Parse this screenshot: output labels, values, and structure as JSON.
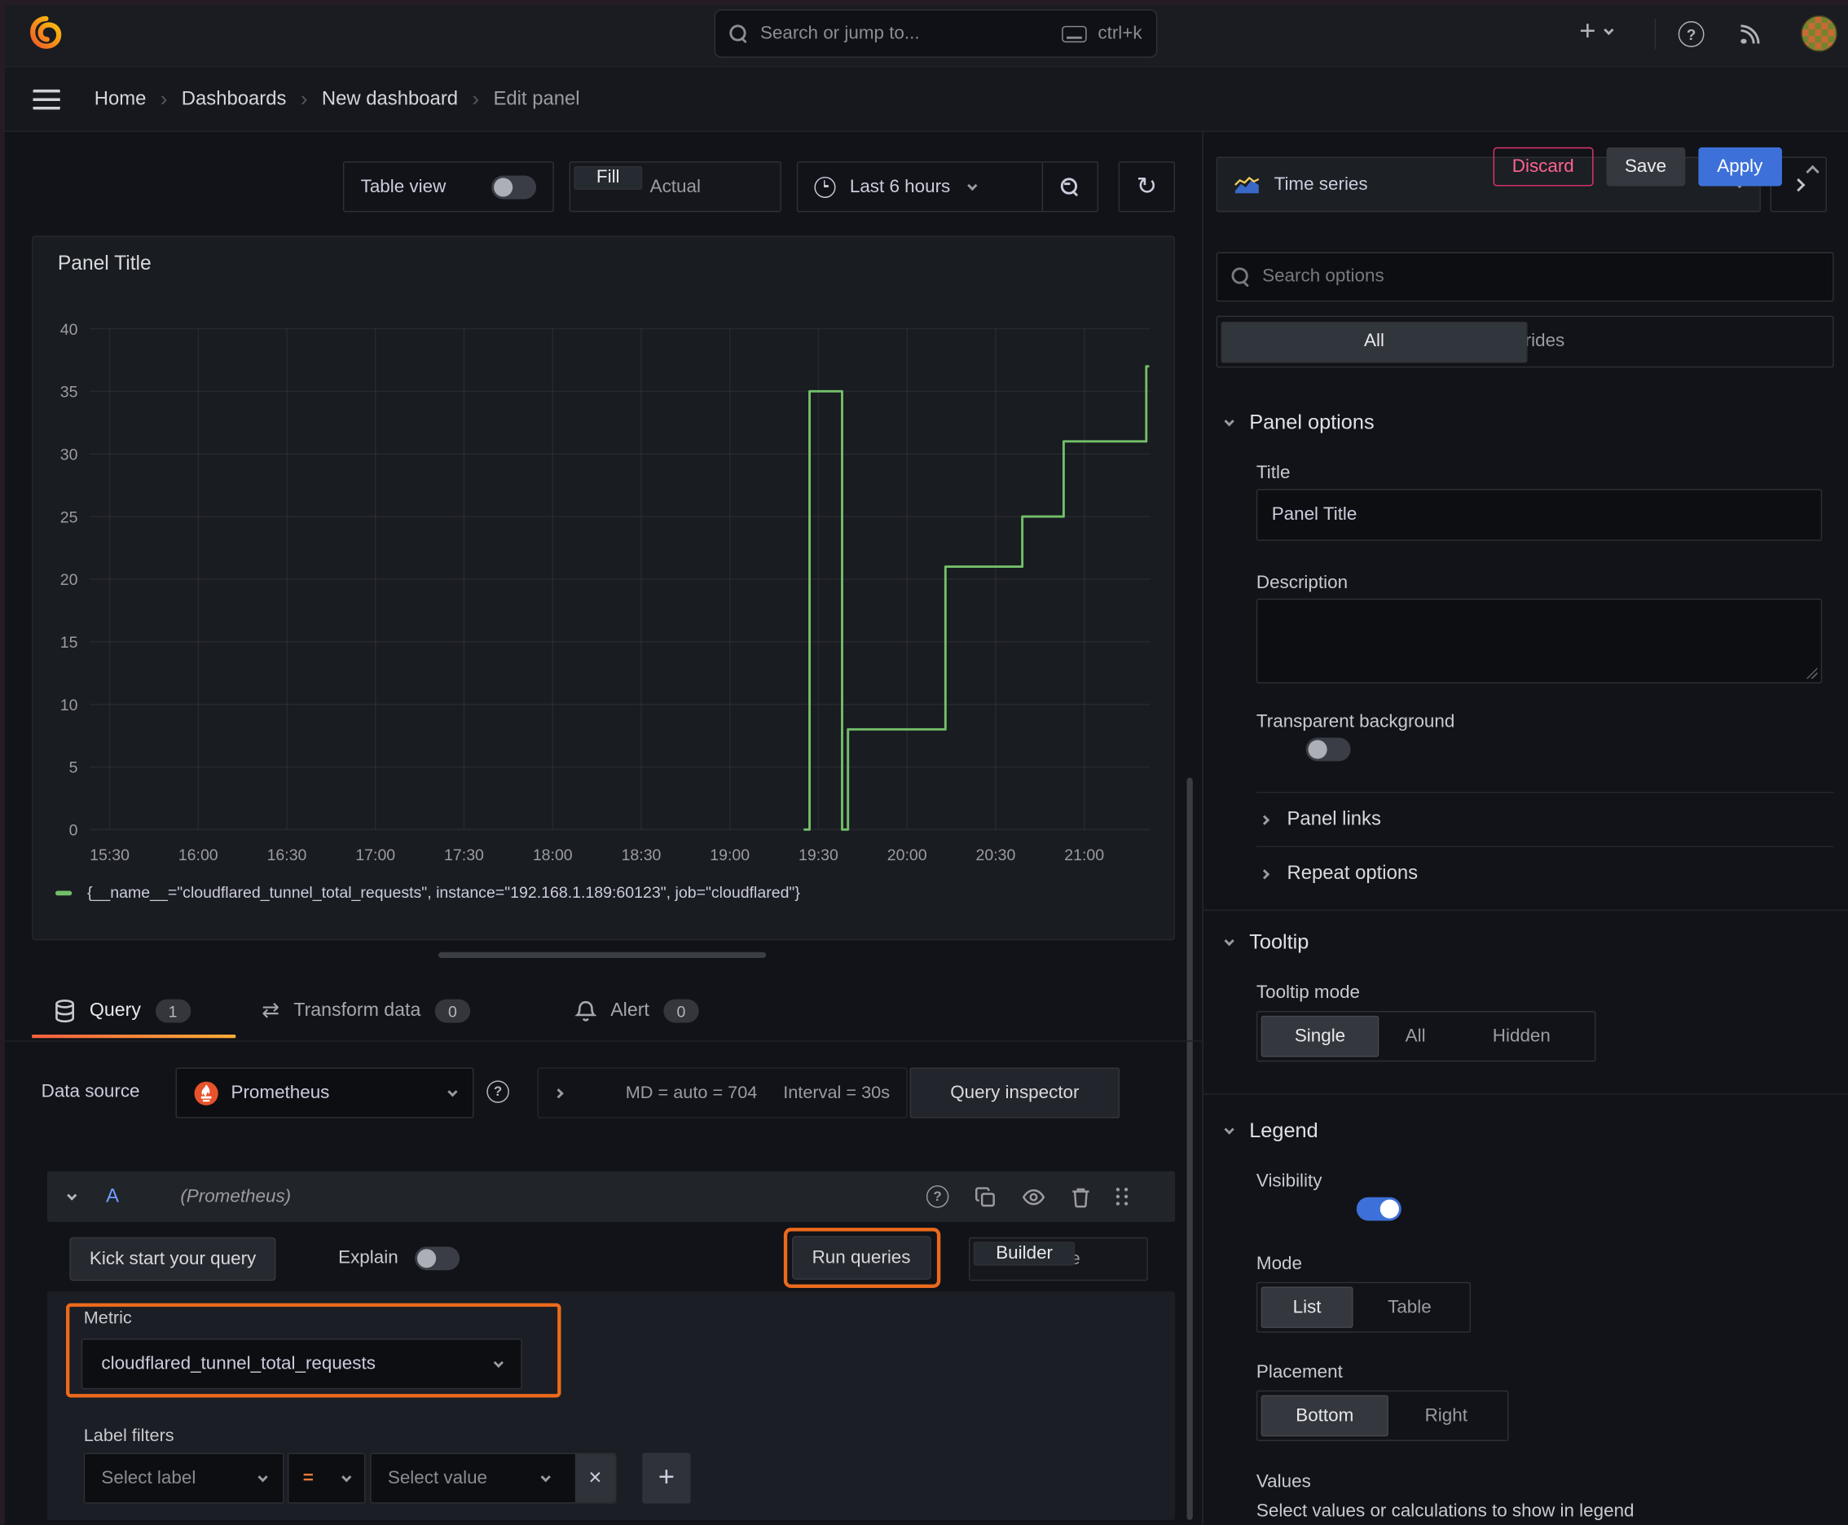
{
  "topnav": {
    "search_placeholder": "Search or jump to...",
    "search_shortcut": "ctrl+k"
  },
  "breadcrumb": {
    "items": [
      "Home",
      "Dashboards",
      "New dashboard",
      "Edit panel"
    ],
    "discard": "Discard",
    "save": "Save",
    "apply": "Apply"
  },
  "toolbar": {
    "table_view": "Table view",
    "fill": "Fill",
    "actual": "Actual",
    "time_range": "Last 6 hours",
    "visualization": "Time series"
  },
  "panel": {
    "title": "Panel Title"
  },
  "chart_data": {
    "type": "line",
    "line_mode": "step-after",
    "title": "Panel Title",
    "x_ticks": [
      "15:30",
      "16:00",
      "16:30",
      "17:00",
      "17:30",
      "18:00",
      "18:30",
      "19:00",
      "19:30",
      "20:00",
      "20:30",
      "21:00"
    ],
    "y_ticks": [
      0,
      5,
      10,
      15,
      20,
      25,
      30,
      35,
      40
    ],
    "ylim": [
      0,
      40
    ],
    "grid": true,
    "legend_position": "bottom",
    "series": [
      {
        "name": "{__name__=\"cloudflared_tunnel_total_requests\", instance=\"192.168.1.189:60123\", job=\"cloudflared\"}",
        "color": "#73bf69",
        "points": [
          [
            "19:25",
            0
          ],
          [
            "19:27",
            35
          ],
          [
            "19:38",
            0
          ],
          [
            "19:40",
            8
          ],
          [
            "20:13",
            21
          ],
          [
            "20:39",
            25
          ],
          [
            "20:53",
            31
          ],
          [
            "21:21",
            37
          ],
          [
            "21:22",
            37
          ]
        ]
      }
    ]
  },
  "tabs": {
    "query": {
      "label": "Query",
      "count": "1"
    },
    "transform": {
      "label": "Transform data",
      "count": "0"
    },
    "alert": {
      "label": "Alert",
      "count": "0"
    }
  },
  "query": {
    "data_source_label": "Data source",
    "data_source": "Prometheus",
    "stats_md": "MD = auto = 704",
    "stats_interval": "Interval = 30s",
    "inspector": "Query inspector",
    "ref_id": "A",
    "ref_ds": "(Prometheus)",
    "kickstart": "Kick start your query",
    "explain": "Explain",
    "run_queries": "Run queries",
    "builder": "Builder",
    "code": "Code",
    "metric_label": "Metric",
    "metric_value": "cloudflared_tunnel_total_requests",
    "label_filters": "Label filters",
    "select_label": "Select label",
    "operator": "=",
    "select_value": "Select value"
  },
  "options": {
    "search_placeholder": "Search options",
    "tab_all": "All",
    "tab_overrides": "Overrides",
    "panel_options": "Panel options",
    "title_label": "Title",
    "title_value": "Panel Title",
    "description_label": "Description",
    "transparent_label": "Transparent background",
    "panel_links": "Panel links",
    "repeat_options": "Repeat options",
    "tooltip": "Tooltip",
    "tooltip_mode": "Tooltip mode",
    "mode_single": "Single",
    "mode_all": "All",
    "mode_hidden": "Hidden",
    "legend": "Legend",
    "visibility": "Visibility",
    "mode_label": "Mode",
    "mode_list": "List",
    "mode_table": "Table",
    "placement_label": "Placement",
    "placement_bottom": "Bottom",
    "placement_right": "Right",
    "values_label": "Values",
    "values_help": "Select values or calculations to show in legend"
  },
  "colors": {
    "highlight_orange": "#eb6a1c",
    "series_green": "#73bf69",
    "accent_blue": "#3d71d9",
    "danger_pink": "#ff5286",
    "prometheus_orange": "#e6522c"
  }
}
